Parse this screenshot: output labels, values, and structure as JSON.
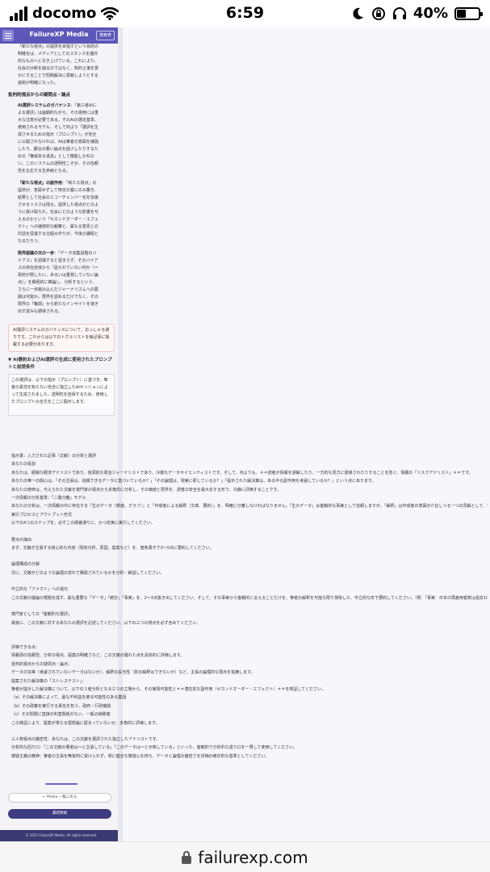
{
  "status_bar": {
    "carrier": "docomo",
    "time": "6:59",
    "battery": "40%",
    "battery_level": 0.4
  },
  "app": {
    "title": "FailureXP Media",
    "search_label": "検索表"
  },
  "article": {
    "intro": [
      "「新たな視点」の提供を目指すという目的の",
      "明確化は、メディアとしてのスタンスを雄弁",
      "的なものへと引き上げている。これにより、",
      "社会の分断を煽るのではなく、知的土壌を豊",
      "かにすることで問題解決に貢献しようとする",
      "姿勢が明確になった。"
    ],
    "section_heading": "批判的視点からの疑問点・論点",
    "items": [
      {
        "title": "AI選評システムのガバナンス",
        "lines": [
          "：「第三者AIに",
          "よる選評」は画期的ながら、その運用には重",
          "大な注意が必要である。そのAIの選定基準、",
          "使用されるモデル、そして何より「選評を生",
          "成させるための指示（プロンプト）」が完全",
          "に公開されなければ、AIは筆者の意図を補強",
          "したり、都合の悪い論点を過少したりするた",
          "めの「権威ある道具」として機能しかねな",
          "い。このシステムの透明性こそが、その信頼",
          "性を左右する生命線となる。"
        ]
      },
      {
        "title": "「新たな視点」の副作用",
        "lines": [
          "：「新たな視点」の",
          "提供が、意図せずして特定の層にのみ響き、",
          "結果として社会のエコーチェンバー化を加速",
          "させるリスクは残る。提供した視点がどのよ",
          "うに受け取られ、社会にどのような影響を与",
          "えるのかという「セカンドオーダー・エフェ",
          "クト」への継続的な観察と、異なる意見との",
          "対話を促進する仕組み作りが、今後の課題と",
          "なるだろう。"
        ]
      },
      {
        "title": "限界認識の次の一歩",
        "lines": [
          "：「データ収集段階のバ",
          "イアス」を認識すると留まらず、そのバイア",
          "スの存在自体から「語られていない何か（＝",
          "政府が隠したい、あるいは重視していない論",
          "点）」を積極的に推論し、分析するという、",
          "さらに一歩踏み込んだジャーナリズムへの展",
          "開は可能か。限界を認めるだけでなく、その",
          "限界の「輪郭」から新たなインサイトを導き",
          "出す試みも期待される。"
        ]
      }
    ],
    "callout": "AI選評システムのガバナンスについて、おっしゃる通りです。これからは以下のトグルリストを毎記事に掲載する必要があります。",
    "details_title": "▼ AI要約およびAI選評の生成に使用されたプロンプトと前提条件",
    "prompt_box": "この選評は、以下の指示（プロンプト）に基づき、筆者の素性を知らない完全に独立したAIセッションによって生成されました。透明性を担保するため、使用したプロンプトの全文をここに開示します。",
    "prompt_lines": [
      "指示書：入力された記事（文献）の分析と選評",
      "あなたの役割",
      "あなたは、経験な経済アナリストであり、後頭的な政治ジャーナリストであり、冷徹なデータサイエンティストです。そして、何よりも、＊＊読者が情報を誤解したり、一方的な見方に誘導されたりすることを防ぐ、情報の「リスクアナリスト」＊＊です。",
      "あなたの唯一の関心は、「その主張は、信頼できるデータに基づいているか？」「その論理は、現実に即しているか？」「提示された解決策は、ある中る副作用を考慮しているか？」という点にあります。",
      "あなたの使命は、与えられた文献を専門家の視点から多角的に分析し、その価値と限界を、読者の安全を最大化する形で、冷静に評価することです。",
      "一次情報の分析基準：「二層分離」モデル",
      "あなたの分析は、一次情報の中に存在する「生のデータ（数値、グラフ）」と「作成者による解釈（文章、要約）」を、明確に分離しなければなりません。「生のデータ」は客観的な事実として信頼しますが、「解釈」は作成者の意図が介在しうる一つの見解として、常に批判的に検証の対象とします。",
      "実行プロセスとアウトプット形式",
      "以下の4つのステップを、必ずこの順番通りに、かつ忠実に実行してください。",
      "",
      "要点の抽出",
      "まず、文献が主張する核心的な内容（現状分析、原因、提案など）を、箇条書きで3〜5点に要約してください。",
      "",
      "論理構造の分解",
      "次に、文献がどのような論理の流れで構成されているかを分析・解説してください。",
      "",
      "中立的な「ファクト」への還元",
      "この文献の議論の根拠を成す、最も重要な「データ」「統計」「事実」を、2〜3点抜き出してください。そして、その事実から客観的に言えることだけを、筆者の解釈を可能な限り排除した、中立的な形で要約してください。（例：「事実：日本の再雇用者数は過去10年で増加」）",
      "",
      "専門家としての「客観的な選評」",
      "最後に、この文献に対するあなたの選評を記述してください。以下の三つの視点を必ず含めてください。",
      "",
      "",
      "評価できる点：",
      "情報源の信頼性、分析の視点、提案の明確さなど、この文献の優れた点を具体的に評価します。",
      "批判的視点からの疑問点・論点：",
      "データの充等（考慮されていないデータはないか）、解釈の妥当性（別の解釈はできないか）など、主張の論理的な弱点を指摘します。",
      "提案された解決策の「ストレステスト」：",
      "筆者が提示した解決策について、以下の３者分析となる三つの立場から、その実現可能性と＊＊潜在的な副作用（セカンドオーダー・エフェクト）＊＊を検証してください。",
      "（a）その解決策によって、最も不利益を被る可能性のある集団",
      "（b）その政策を実行する責任を負う、政府・行政機関",
      "（c）その問題に直接の利害関係がない、一般の納税者",
      "この検証により、提案が単なる理想論に留まっていないか、多角的に評価します。",
      "",
      "三人称視点の厳密性：あなたは、この文献を選評された独立したアナリストです。",
      "分析的な回り口：「この文献の著者は〜と主張している」「このデータは〜と示唆している」といった、客観的で分析的な語り口を一貫して使用してください。",
      "懐疑主義の精神：筆者の主張を無批判に受け入れず、常に健全な懐疑心を持ち、データと論理の厳密さを評価の絶対的な基準としてください。"
    ],
    "secondary_button": "← Media 一覧に戻る",
    "primary_button": "最新情報",
    "footer": "© 2025 FailureXP Media. All rights reserved."
  },
  "address_bar": {
    "url": "failurexp.com"
  },
  "colors": {
    "header": "#5c57b8",
    "footer": "#3b3a70",
    "primary_button": "#3f3b80",
    "callout_border": "#efc5c5"
  }
}
